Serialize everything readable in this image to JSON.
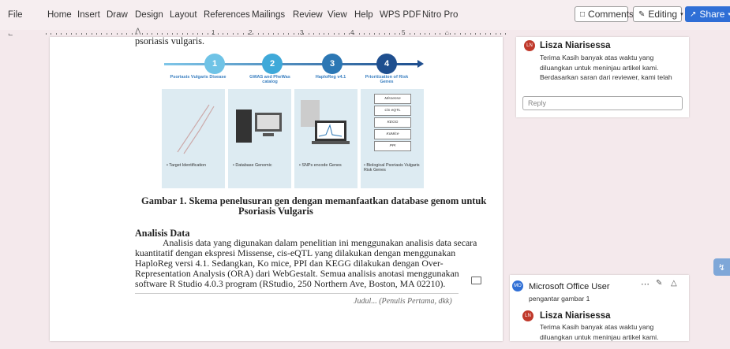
{
  "menu": [
    "File",
    "Home",
    "Insert",
    "Draw",
    "Design",
    "Layout",
    "References",
    "Mailings",
    "Review",
    "View",
    "Help",
    "WPS PDF",
    "Nitro Pro"
  ],
  "buttons": {
    "comments": "Comments",
    "editing": "Editing",
    "share": "Share"
  },
  "ruler_numbers": [
    "1",
    "2",
    "3",
    "4",
    "5"
  ],
  "doc": {
    "top_line": "psoriasis vulgaris.",
    "figure": {
      "steps": [
        "1",
        "2",
        "3",
        "4"
      ],
      "step_labels": [
        "Psoriasis Vulgaris Disease",
        "GWAS and PheWas catalog",
        "HaploReg v4.1",
        "Prioritization of Risk Genes"
      ],
      "bullets": [
        "Target Identification",
        "Database Genomic",
        "SNPs encode Genes",
        "Biological Psoriasis Vulgaris Risk Genes"
      ],
      "genes": [
        "Missense",
        "Cis eQTL",
        "KEGG",
        "KoMice",
        "PPI"
      ]
    },
    "caption_line1": "Gambar 1. Skema penelusuran gen dengan memanfaatkan database genom untuk",
    "caption_line2": "Psoriasis Vulgaris",
    "heading": "Analisis Data",
    "para": [
      "Analisis data yang digunakan dalam penelitian ini menggunakan analisis data secara",
      "kuantitatif dengan ekspresi Missense, cis-eQTL yang dilakukan dengan menggunakan",
      "HaploReg versi 4.1. Sedangkan, Ko mice, PPI dan KEGG dilakukan dengan Over-",
      "Representation Analysis (ORA) dari WebGestalt. Semua analisis anotasi menggunakan",
      "software R Studio 4.0.3 program (RStudio, 250 Northern Ave, Boston, MA 02210)."
    ],
    "footer": "Judul... (Penulis Pertama, dkk)"
  },
  "comment1": {
    "initials": "LN",
    "author": "Lisza Niarisessa",
    "lines": [
      "Terima Kasih banyak atas waktu yang",
      "diluangkan untuk meninjau artikel kami.",
      "Berdasarkan saran dari reviewer, kami telah"
    ],
    "reply_placeholder": "Reply"
  },
  "comment2": {
    "initials": "MO",
    "author": "Microsoft Office User",
    "text": "pengantar gambar 1",
    "reply_initials": "LN",
    "reply_author": "Lisza Niarisessa",
    "reply_lines": [
      "Terima Kasih banyak atas waktu yang",
      "diluangkan untuk meninjau artikel kami."
    ]
  },
  "colors": {
    "accent": "#2f6fd6",
    "avatar_ln": "#c0392b",
    "avatar_mo": "#2f6fd6",
    "step_blue": "#3fa9d9",
    "step_dark": "#1f4f8f"
  }
}
